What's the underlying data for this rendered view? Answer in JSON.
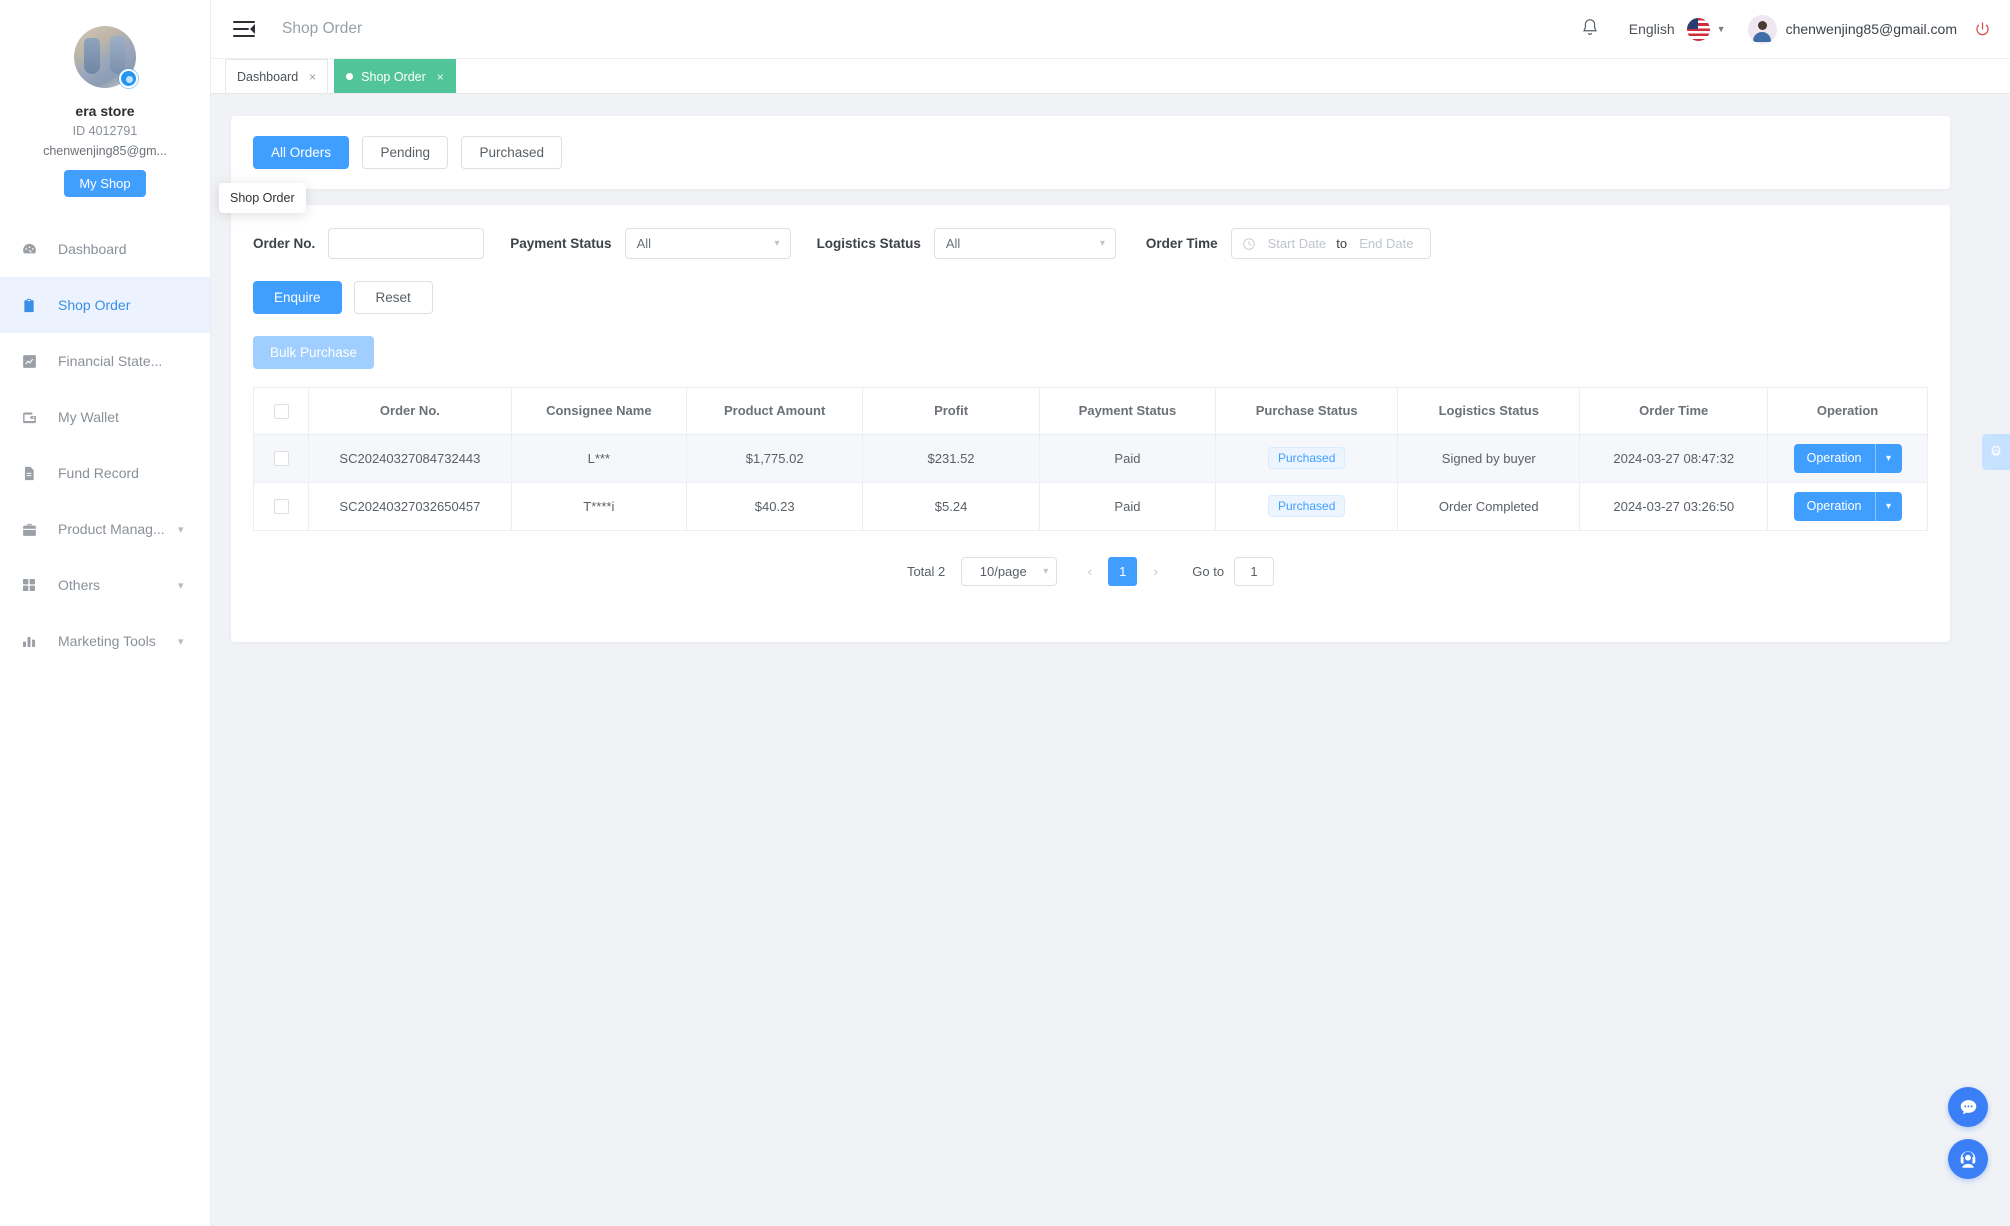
{
  "sidebar": {
    "store_name": "era store",
    "store_id": "ID 4012791",
    "store_email": "chenwenjing85@gm...",
    "my_shop_label": "My Shop",
    "items": [
      {
        "label": "Dashboard",
        "icon": "dashboard-icon",
        "active": false,
        "expandable": false
      },
      {
        "label": "Shop Order",
        "icon": "clipboard-icon",
        "active": true,
        "expandable": false
      },
      {
        "label": "Financial State...",
        "icon": "chart-line-icon",
        "active": false,
        "expandable": false
      },
      {
        "label": "My Wallet",
        "icon": "wallet-icon",
        "active": false,
        "expandable": false
      },
      {
        "label": "Fund Record",
        "icon": "document-icon",
        "active": false,
        "expandable": false
      },
      {
        "label": "Product Manag...",
        "icon": "briefcase-icon",
        "active": false,
        "expandable": true
      },
      {
        "label": "Others",
        "icon": "grid-icon",
        "active": false,
        "expandable": true
      },
      {
        "label": "Marketing Tools",
        "icon": "bar-chart-icon",
        "active": false,
        "expandable": true
      }
    ]
  },
  "topbar": {
    "page_title": "Shop Order",
    "language": "English",
    "user_email": "chenwenjing85@gmail.com"
  },
  "tabs": [
    {
      "label": "Dashboard",
      "active": false
    },
    {
      "label": "Shop Order",
      "active": true
    }
  ],
  "segments": [
    {
      "label": "All Orders",
      "active": true
    },
    {
      "label": "Pending",
      "active": false
    },
    {
      "label": "Purchased",
      "active": false
    }
  ],
  "filters": {
    "order_no_label": "Order No.",
    "order_no_value": "",
    "order_no_placeholder": "",
    "payment_status_label": "Payment Status",
    "payment_status_value": "All",
    "logistics_status_label": "Logistics Status",
    "logistics_status_value": "All",
    "order_time_label": "Order Time",
    "start_date_placeholder": "Start Date",
    "to_label": "to",
    "end_date_placeholder": "End Date",
    "enquire_label": "Enquire",
    "reset_label": "Reset"
  },
  "tooltip": {
    "text": "Shop Order"
  },
  "table": {
    "bulk_purchase_label": "Bulk Purchase",
    "columns": [
      "Order No.",
      "Consignee Name",
      "Product Amount",
      "Profit",
      "Payment Status",
      "Purchase Status",
      "Logistics Status",
      "Order Time",
      "Operation"
    ],
    "rows": [
      {
        "order_no": "SC20240327084732443",
        "consignee": "L***",
        "product_amount": "$1,775.02",
        "profit": "$231.52",
        "payment_status": "Paid",
        "purchase_status": "Purchased",
        "logistics_status": "Signed by buyer",
        "order_time": "2024-03-27 08:47:32",
        "operation": "Operation"
      },
      {
        "order_no": "SC20240327032650457",
        "consignee": "T****i",
        "product_amount": "$40.23",
        "profit": "$5.24",
        "payment_status": "Paid",
        "purchase_status": "Purchased",
        "logistics_status": "Order Completed",
        "order_time": "2024-03-27 03:26:50",
        "operation": "Operation"
      }
    ]
  },
  "pagination": {
    "total": "Total 2",
    "page_size": "10/page",
    "current_page": "1",
    "goto_label": "Go to",
    "goto_value": "1"
  },
  "colors": {
    "primary": "#409eff",
    "tab_active": "#52c49a",
    "sidebar_active_bg": "#ecf3fe",
    "disabled_primary": "#a0cfff",
    "tag_text": "#409eff",
    "tag_bg": "#ecf5ff"
  }
}
